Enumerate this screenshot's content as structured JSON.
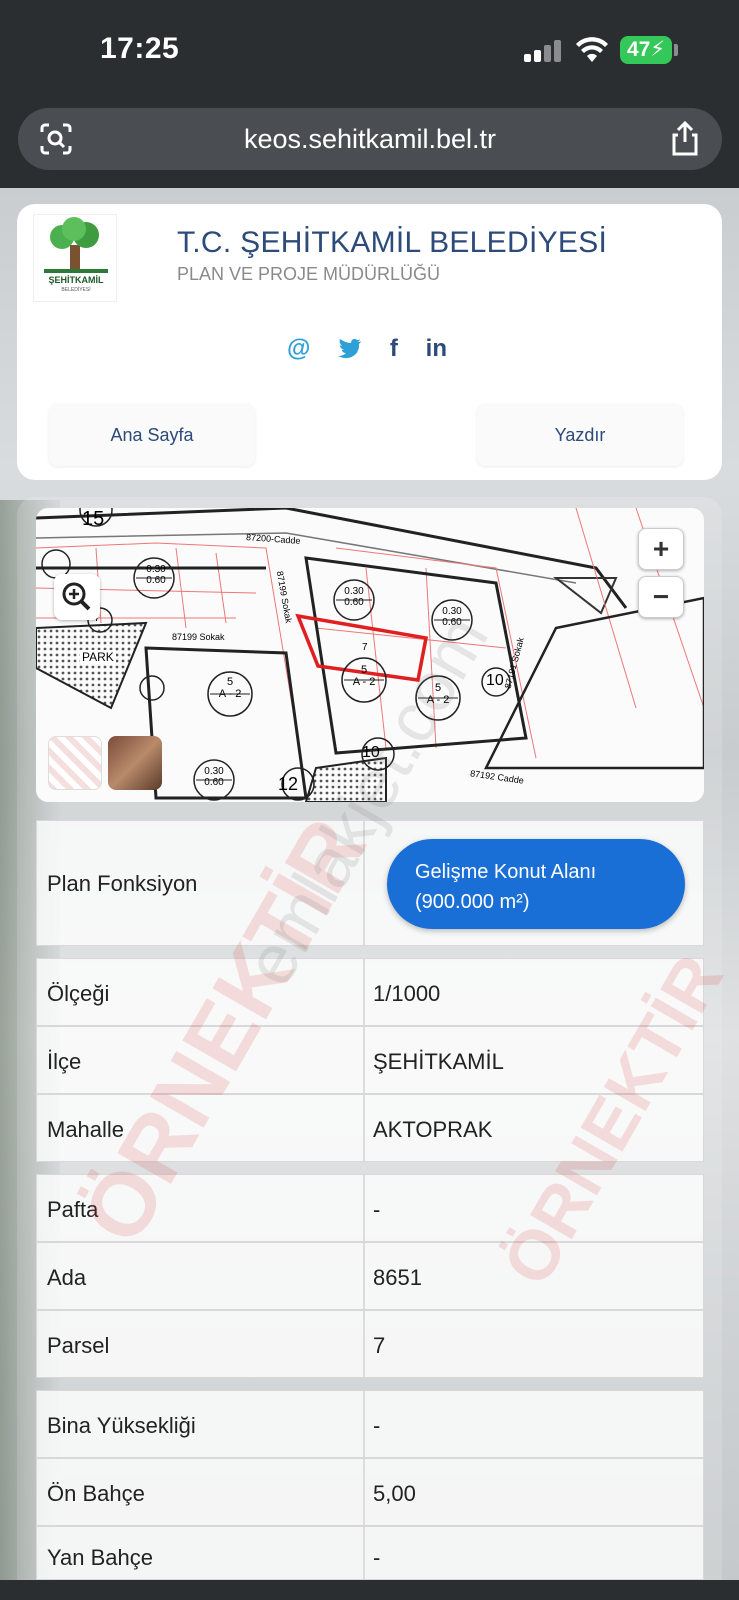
{
  "status_bar": {
    "time": "17:25",
    "battery": "47"
  },
  "browser": {
    "url": "keos.sehitkamil.bel.tr"
  },
  "header": {
    "logo_text": "ŞEHİTKAMİL",
    "logo_sub": "BELEDİYESİ",
    "title": "T.C. ŞEHİTKAMİL BELEDİYESİ",
    "subtitle": "PLAN VE PROJE MÜDÜRLÜĞÜ",
    "social": [
      "@",
      "twitter",
      "f",
      "in"
    ],
    "nav": {
      "home": "Ana Sayfa",
      "print": "Yazdır"
    }
  },
  "map": {
    "zoom_in": "+",
    "zoom_out": "−",
    "labels": {
      "park": "PARK",
      "street_top": "87200-Cadde",
      "street_sokak": "87199 Sokak",
      "street_bottom": "87192 Cadde",
      "street_vertical": "87199 Sokak",
      "street_right": "87191 Sokak",
      "num_15": "15",
      "num_10a": "10",
      "num_10b": "10",
      "num_12": "12",
      "num_7": "7",
      "num_5": "5",
      "zone_a2": "A - 2",
      "ratio_top": "0.30",
      "ratio_bottom": "0.60"
    }
  },
  "details": {
    "plan_fonksiyon": {
      "label": "Plan Fonksiyon",
      "value_line1": "Gelişme Konut Alanı",
      "value_line2": "(900.000 m²)"
    },
    "rows_group1": [
      {
        "label": "Ölçeği",
        "value": "1/1000"
      },
      {
        "label": "İlçe",
        "value": "ŞEHİTKAMİL"
      },
      {
        "label": "Mahalle",
        "value": "AKTOPRAK"
      }
    ],
    "rows_group2": [
      {
        "label": "Pafta",
        "value": "-"
      },
      {
        "label": "Ada",
        "value": "8651"
      },
      {
        "label": "Parsel",
        "value": "7"
      }
    ],
    "rows_group3": [
      {
        "label": "Bina Yüksekliği",
        "value": "-"
      },
      {
        "label": "Ön Bahçe",
        "value": "5,00"
      },
      {
        "label": "Yan Bahçe",
        "value": "-"
      }
    ]
  },
  "watermark": {
    "red": "ÖRNEKTİR",
    "gray": "emlakjet.com"
  },
  "colors": {
    "accent": "#1a6fd6",
    "title": "#2c4a7a",
    "parcel_outline": "#e02020",
    "battery": "#34c759"
  }
}
